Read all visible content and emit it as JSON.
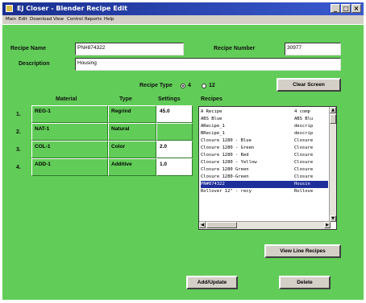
{
  "window": {
    "title": "EJ Closer - Blender Recipe Edit"
  },
  "menu": [
    "Main",
    "Edit",
    "Download",
    "View",
    "Control",
    "Reports",
    "Help"
  ],
  "form": {
    "recipe_name_label": "Recipe Name",
    "recipe_name_value": "PN#874322",
    "recipe_number_label": "Recipe Number",
    "recipe_number_value": "30977",
    "description_label": "Description",
    "description_value": "Housing",
    "recipe_type_label": "Recipe Type",
    "recipe_type_options": [
      "4",
      "12"
    ],
    "recipe_type_selected": "4"
  },
  "buttons": {
    "clear_screen": "Clear Screen",
    "view_line_recipes": "View Line Recipes",
    "add_update": "Add/Update",
    "delete": "Delete"
  },
  "table": {
    "headers": {
      "material": "Material",
      "type": "Type",
      "settings": "Settings"
    },
    "rows": [
      {
        "num": "1.",
        "material": "REG-1",
        "type": "Regrind",
        "settings": "45.0"
      },
      {
        "num": "2.",
        "material": "NAT-1",
        "type": "Natural",
        "settings": ""
      },
      {
        "num": "3.",
        "material": "COL-1",
        "type": "Color",
        "settings": "2.0"
      },
      {
        "num": "4.",
        "material": "ADD-1",
        "type": "Additive",
        "settings": "1.0"
      }
    ]
  },
  "recipes": {
    "label": "Recipes",
    "items": [
      {
        "name": "A Recipe",
        "desc": "4 comp"
      },
      {
        "name": "ABS Blue",
        "desc": "ABS Blu"
      },
      {
        "name": "ARecipe_1",
        "desc": "descrip"
      },
      {
        "name": "BRecipe_1",
        "desc": "descrip"
      },
      {
        "name": "Closure 1280 - Blue",
        "desc": "Closure"
      },
      {
        "name": "Closure 1280 - Green",
        "desc": "Closure"
      },
      {
        "name": "Closure 1280 - Red",
        "desc": "Closure"
      },
      {
        "name": "Closure 1280 - Yellow",
        "desc": "Closure"
      },
      {
        "name": "Closure 1280 Green",
        "desc": "Closure"
      },
      {
        "name": "Closure 1280-Green",
        "desc": "Closure"
      },
      {
        "name": "PN#874322",
        "desc": "Housin"
      },
      {
        "name": "Rollover 12\" - recy",
        "desc": "Rollove"
      }
    ],
    "selected_index": 10
  }
}
